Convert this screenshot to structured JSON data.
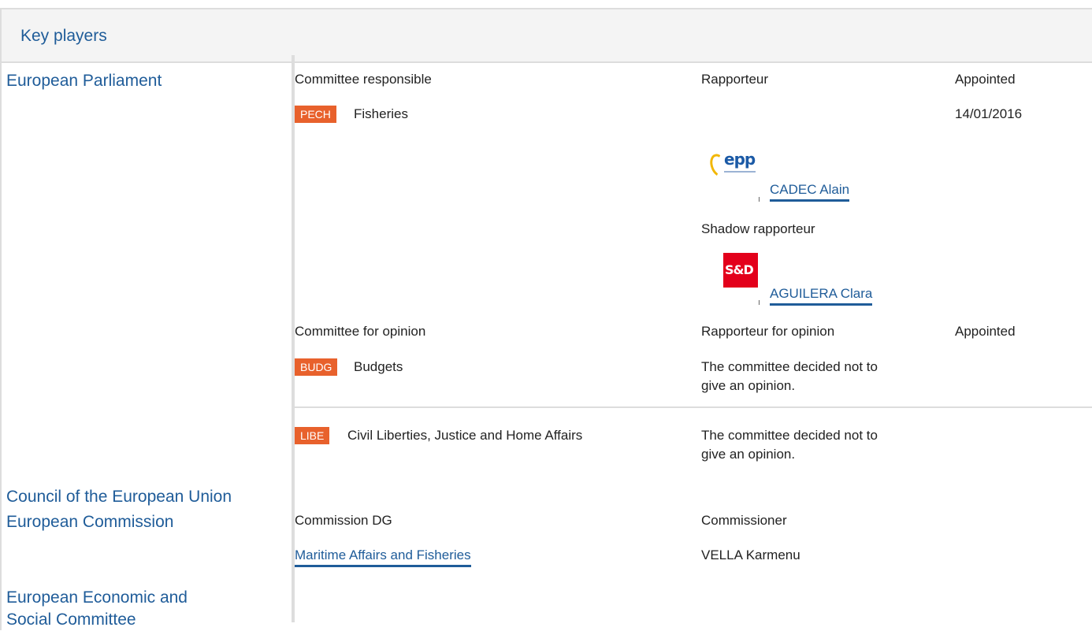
{
  "section": {
    "title": "Key players"
  },
  "institutions": {
    "ep": "European Parliament",
    "council": "Council of the European Union",
    "commission": "European Commission",
    "eesc_line1": "European Economic and",
    "eesc_line2": "Social Committee"
  },
  "ep": {
    "responsible_header": "Committee responsible",
    "rapporteur_header": "Rapporteur",
    "appointed_header": "Appointed",
    "responsible": {
      "badge": "PECH",
      "name": "Fisheries",
      "appointed": "14/01/2016",
      "rapporteur": {
        "group_logo": "epp-logo",
        "group_text": "epp",
        "name": "CADEC Alain"
      },
      "shadow_label": "Shadow rapporteur",
      "shadow": {
        "group_logo": "sd-logo",
        "group_text": "S&D",
        "name": "AGUILERA Clara"
      }
    },
    "opinion_header": "Committee for opinion",
    "rapporteur_opinion_header": "Rapporteur for opinion",
    "appointed_opinion_header": "Appointed",
    "opinions": [
      {
        "badge": "BUDG",
        "name": "Budgets",
        "note_line1": "The committee decided not to",
        "note_line2": "give an opinion."
      },
      {
        "badge": "LIBE",
        "name": "Civil Liberties, Justice and Home Affairs",
        "note_line1": "The committee decided not to",
        "note_line2": "give an opinion."
      }
    ]
  },
  "commission": {
    "dg_header": "Commission DG",
    "commissioner_header": "Commissioner",
    "dg": "Maritime Affairs and Fisheries",
    "commissioner": "VELLA Karmenu"
  },
  "colors": {
    "link": "#1f5c99",
    "badge": "#e8612c",
    "border": "#dddddd",
    "header_bg": "#f4f4f4"
  }
}
